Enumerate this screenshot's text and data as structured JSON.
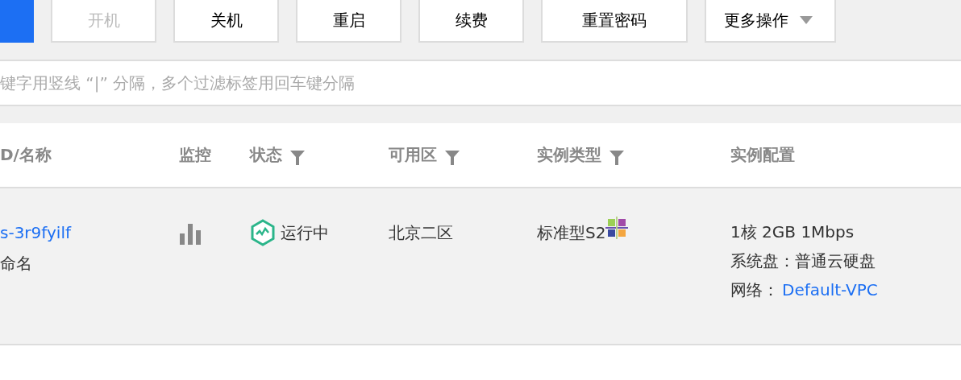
{
  "toolbar": {
    "buttons": [
      {
        "kind": "primary"
      },
      {
        "kind": "plain",
        "label": "开机",
        "disabled": true
      },
      {
        "kind": "plain",
        "label": "关机",
        "disabled": false
      },
      {
        "kind": "plain",
        "label": "重启",
        "disabled": false
      },
      {
        "kind": "plain",
        "label": "续费",
        "disabled": false
      },
      {
        "kind": "plain",
        "label": "重置密码",
        "disabled": false
      },
      {
        "kind": "dropdown",
        "label": "更多操作",
        "disabled": false
      }
    ]
  },
  "search": {
    "placeholder": "键字用竖线 “|” 分隔，多个过滤标签用回车键分隔"
  },
  "table": {
    "columns": [
      {
        "label": "D/名称",
        "filter": false
      },
      {
        "label": "监控",
        "filter": false
      },
      {
        "label": "状态",
        "filter": true
      },
      {
        "label": "可用区",
        "filter": true
      },
      {
        "label": "实例类型",
        "filter": true
      },
      {
        "label": "实例配置",
        "filter": false
      }
    ],
    "rows": [
      {
        "id": "s-3r9fyilf",
        "name": "命名",
        "status": {
          "kind": "running",
          "label": "运行中"
        },
        "zone": "北京二区",
        "type": "标准型S2",
        "config": "1核 2GB 1Mbps",
        "disk": "系统盘：普通云硬盘",
        "network_label": "网络：",
        "network": "Default-VPC"
      }
    ]
  }
}
